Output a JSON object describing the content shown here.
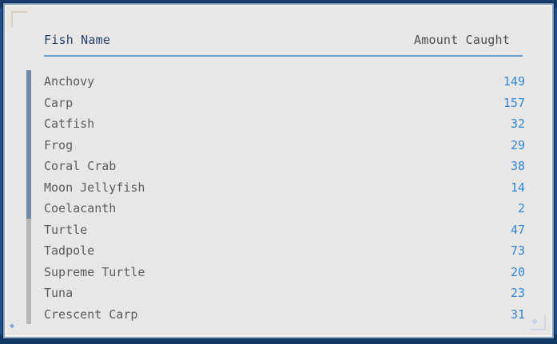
{
  "table": {
    "header": {
      "name_label": "Fish Name",
      "amount_label": "Amount Caught"
    },
    "rows": [
      {
        "name": "Anchovy",
        "count": "149"
      },
      {
        "name": "Carp",
        "count": "157"
      },
      {
        "name": "Catfish",
        "count": "32"
      },
      {
        "name": "Frog",
        "count": "29"
      },
      {
        "name": "Coral Crab",
        "count": "38"
      },
      {
        "name": "Moon Jellyfish",
        "count": "14"
      },
      {
        "name": "Coelacanth",
        "count": "2"
      },
      {
        "name": "Turtle",
        "count": "47"
      },
      {
        "name": "Tadpole",
        "count": "73"
      },
      {
        "name": "Supreme Turtle",
        "count": "20"
      },
      {
        "name": "Tuna",
        "count": "23"
      },
      {
        "name": "Crescent Carp",
        "count": "31"
      }
    ]
  },
  "colors": {
    "panel_bg": "#e8e7e5",
    "count_text": "#2f87d6",
    "header_name": "#243f6e",
    "divider": "#6d9bc9",
    "scroll_thumb": "#6f8aa8"
  },
  "icons": {
    "corner_ornament": "shell-icon"
  }
}
